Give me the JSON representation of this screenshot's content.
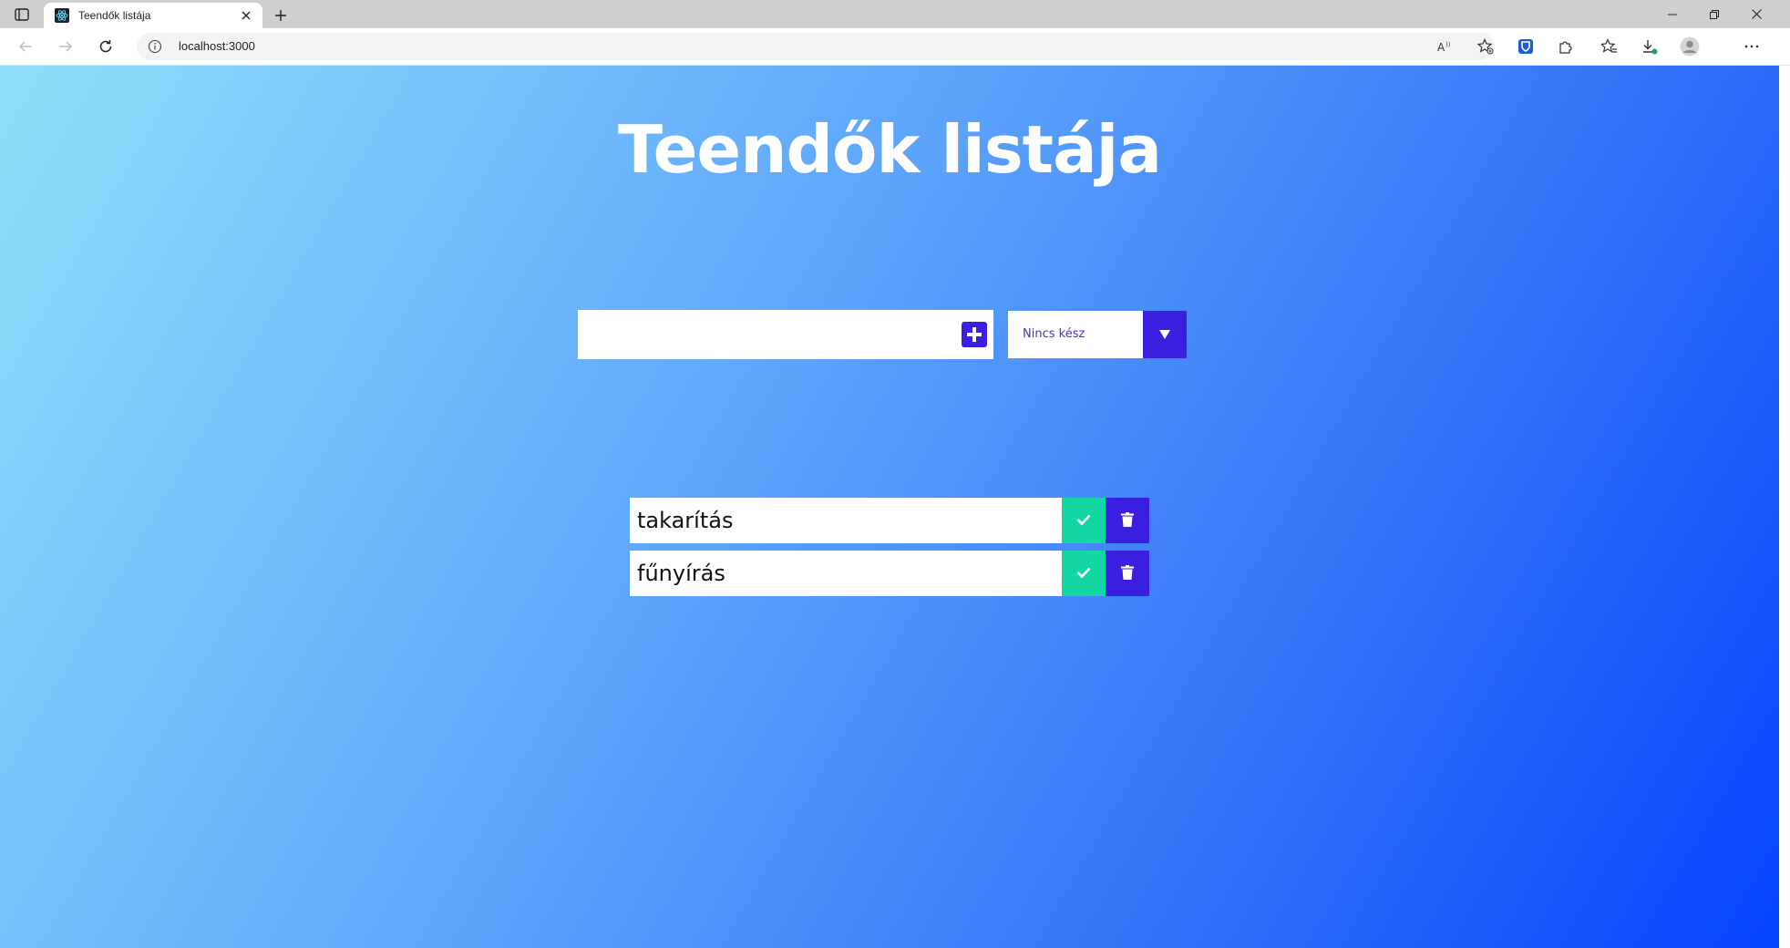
{
  "browser": {
    "tab_title": "Teendők listája",
    "address": "localhost:3000"
  },
  "page": {
    "title": "Teendők listája",
    "input": {
      "value": "",
      "placeholder": ""
    },
    "filter": {
      "selected": "Nincs kész"
    },
    "todos": [
      {
        "text": "takarítás"
      },
      {
        "text": "fűnyírás"
      }
    ]
  },
  "colors": {
    "gradient_start": "#8fe0fa",
    "gradient_end": "#0544ff",
    "accent_purple": "#3a1fe0",
    "complete_green": "#14d6a2"
  },
  "icons": {
    "add": "plus-square-icon",
    "filter": "caret-down-icon",
    "complete": "check-icon",
    "delete": "trash-icon"
  }
}
